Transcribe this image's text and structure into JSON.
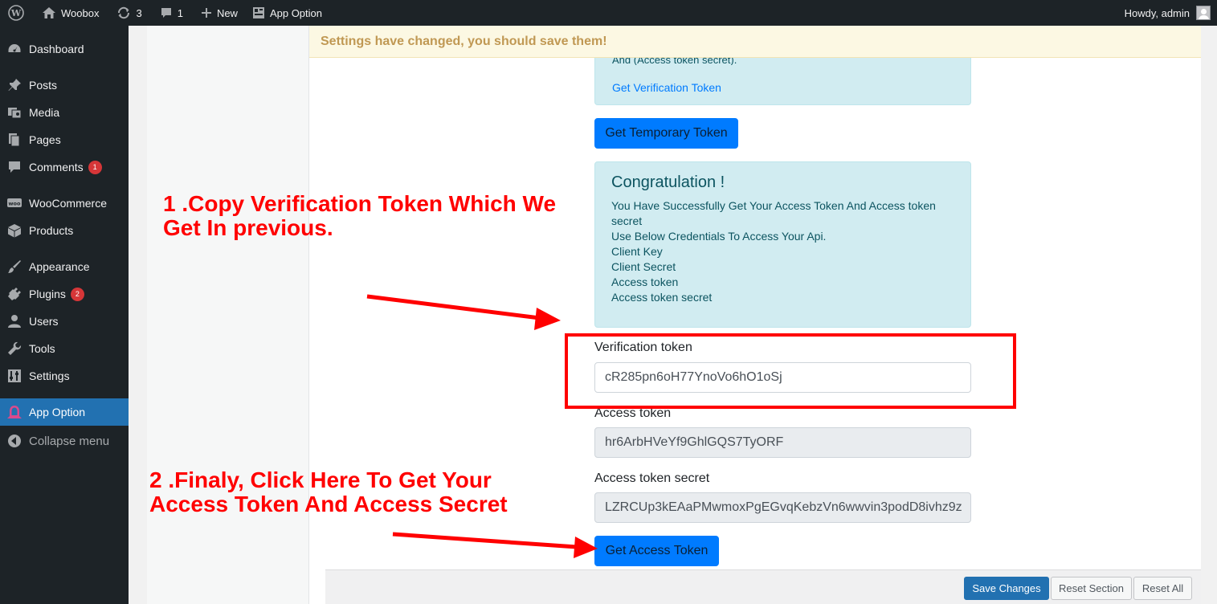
{
  "adminbar": {
    "site_name": "Woobox",
    "updates_count": "3",
    "comments_count": "1",
    "new_label": "New",
    "app_option_label": "App Option",
    "greeting": "Howdy, admin"
  },
  "sidebar": {
    "items": [
      {
        "label": "Dashboard",
        "icon": "dashboard-icon"
      },
      {
        "label": "Posts",
        "icon": "pushpin-icon"
      },
      {
        "label": "Media",
        "icon": "media-icon"
      },
      {
        "label": "Pages",
        "icon": "pages-icon"
      },
      {
        "label": "Comments",
        "icon": "comment-icon",
        "badge": "1"
      },
      {
        "label": "WooCommerce",
        "icon": "woo-icon"
      },
      {
        "label": "Products",
        "icon": "box-icon"
      },
      {
        "label": "Appearance",
        "icon": "brush-icon"
      },
      {
        "label": "Plugins",
        "icon": "plug-icon",
        "badge": "2"
      },
      {
        "label": "Users",
        "icon": "user-icon"
      },
      {
        "label": "Tools",
        "icon": "wrench-icon"
      },
      {
        "label": "Settings",
        "icon": "sliders-icon"
      },
      {
        "label": "App Option",
        "icon": "app-option-icon",
        "active": true
      },
      {
        "label": "Collapse menu",
        "icon": "collapse-icon"
      }
    ]
  },
  "notice": {
    "text": "Settings have changed, you should save them!"
  },
  "box1": {
    "cut_text": "And (Access token secret).",
    "link": "Get Verification Token"
  },
  "buttons": {
    "temp_token": "Get Temporary Token",
    "access_token": "Get Access Token",
    "save": "Save Changes",
    "reset_section": "Reset Section",
    "reset_all": "Reset All"
  },
  "box2": {
    "title": "Congratulation !",
    "lines": [
      "You Have Successfully Get Your Access Token And Access token secret",
      "Use Below Credentials To Access Your Api.",
      "Client Key",
      "Client Secret",
      "Access token",
      "Access token secret"
    ]
  },
  "fields": {
    "verification_label": "Verification token",
    "verification_value": "cR285pn6oH77YnoVo6hO1oSj",
    "access_token_label": "Access token",
    "access_token_value": "hr6ArbHVeYf9GhlGQS7TyORF",
    "access_secret_label": "Access token secret",
    "access_secret_value": "LZRCUp3kEAaPMwmoxPgEGvqKebzVn6wwvin3podD8ivhz9z"
  },
  "annotations": {
    "step1": "1 .Copy Verification Token Which We\nGet In previous.",
    "step2": "2 .Finaly, Click Here To Get Your\nAccess Token And Access Secret",
    "color": "#ff0000"
  },
  "colors": {
    "admin_bg": "#1d2327",
    "active_menu": "#2271b1",
    "primary_button": "#007bff",
    "info_bg": "#d1ecf1",
    "notice_bg": "#fcf8e3"
  }
}
